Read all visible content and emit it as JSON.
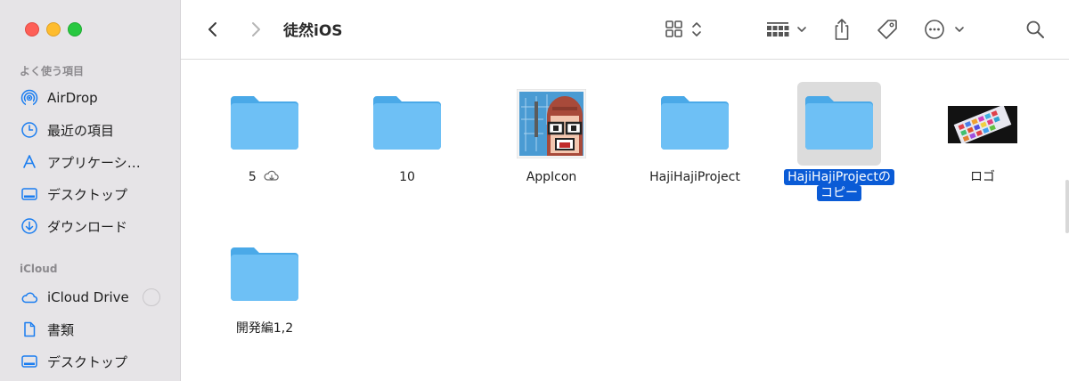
{
  "window": {
    "title": "徒然iOS"
  },
  "sidebar": {
    "favorites_title": "よく使う項目",
    "favorites": [
      {
        "label": "AirDrop",
        "icon": "airdrop-icon"
      },
      {
        "label": "最近の項目",
        "icon": "clock-icon"
      },
      {
        "label": "アプリケーシ…",
        "icon": "applications-icon"
      },
      {
        "label": "デスクトップ",
        "icon": "desktop-icon"
      },
      {
        "label": "ダウンロード",
        "icon": "download-icon"
      }
    ],
    "icloud_title": "iCloud",
    "icloud": [
      {
        "label": "iCloud Drive",
        "icon": "cloud-icon"
      },
      {
        "label": "書類",
        "icon": "document-icon"
      },
      {
        "label": "デスクトップ",
        "icon": "desktop-icon"
      }
    ]
  },
  "items": [
    {
      "name": "5",
      "type": "folder",
      "badge": "cloud-download-icon"
    },
    {
      "name": "10",
      "type": "folder"
    },
    {
      "name": "AppIcon",
      "type": "image"
    },
    {
      "name": "HajiHajiProject",
      "type": "folder"
    },
    {
      "name_line1": "HajiHajiProjectの",
      "name_line2": "コピー",
      "type": "folder",
      "selected": true
    },
    {
      "name": "ロゴ",
      "type": "image"
    },
    {
      "name": "開発編1,2",
      "type": "folder"
    }
  ],
  "colors": {
    "accent": "#0a5bd6",
    "folder": "#6ec0f5",
    "sidebar_bg": "#e6e4e7",
    "sidebar_icon": "#1a7df0"
  }
}
